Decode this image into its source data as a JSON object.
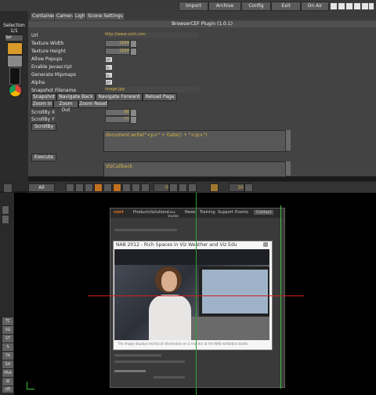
{
  "topbar": {
    "buttons": [
      "Import",
      "Archive",
      "Config",
      "Exit",
      "On Air"
    ]
  },
  "leftcol": {
    "header": "Selection",
    "header2": "1/1",
    "sel": "Sel"
  },
  "tabs": [
    "Container",
    "Camera",
    "Light",
    "Scene Settings"
  ],
  "panel": {
    "title": "BrowserCEF Plugin (1.0.1)",
    "rows": [
      {
        "label": "Url",
        "value": "http://www.vizrt.com"
      },
      {
        "label": "Texture Width",
        "value": "1024"
      },
      {
        "label": "Texture Height",
        "value": "1024"
      },
      {
        "label": "Allow Popups",
        "value": "Off"
      },
      {
        "label": "Enable Javascript",
        "value": "On"
      },
      {
        "label": "Generate Mipmaps",
        "value": "On"
      },
      {
        "label": "Alpha",
        "value": "Off"
      },
      {
        "label": "Snapshot Filename",
        "value": "image.jpg"
      }
    ],
    "buttons_row1": [
      "Snapshot",
      "Navigate Back",
      "Navigate Forward",
      "Reload Page"
    ],
    "buttons_row2": [
      "Zoom In",
      "Zoom Out",
      "Zoom Reset"
    ],
    "scroll_x_label": "ScrollBy X",
    "scroll_x_value": "80",
    "scroll_y_label": "ScrollBy Y",
    "scroll_y_value": "77",
    "scrollby_button": "ScrollBy",
    "script_text": "document.write(\"<p>\" + Date() + \"</p>\")",
    "execute_button": "Execute",
    "callback_text": "VizCallback"
  },
  "toolbar": {
    "all_label": "All",
    "frame_value": "0",
    "fps_value": "30"
  },
  "viewport_buttons": [
    "TC",
    "SG",
    "ST",
    "S",
    "TA",
    "SA",
    "PAA",
    "W",
    "UE",
    "AR"
  ],
  "site": {
    "nav": [
      "vizrt",
      "Products",
      "Solutions",
      "Case studies",
      "News",
      "Training",
      "Support",
      "Events",
      "Contact"
    ],
    "modal_title": "NAB 2012 - Rich Spaces in Viz Weather and Viz Edu",
    "caption": "The image displays technical information on a monitor at the NAB exhibition booth."
  }
}
